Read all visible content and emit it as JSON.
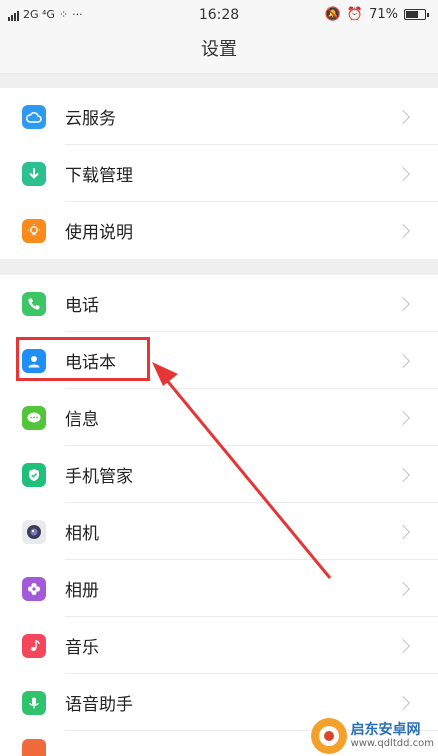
{
  "status_bar": {
    "left": "2G ⁴G",
    "time": "16:28",
    "battery_pct": "71%",
    "battery_level": 0.71
  },
  "header": {
    "title": "设置"
  },
  "sections": [
    {
      "items": [
        {
          "label": "云服务",
          "icon": "cloud-icon",
          "color": "#2f9bf0"
        },
        {
          "label": "下载管理",
          "icon": "download-icon",
          "color": "#2cbf8f"
        },
        {
          "label": "使用说明",
          "icon": "lightbulb-icon",
          "color": "#f98a1c"
        }
      ]
    },
    {
      "items": [
        {
          "label": "电话",
          "icon": "phone-icon",
          "color": "#3ec566"
        },
        {
          "label": "电话本",
          "icon": "contacts-icon",
          "color": "#1f8ff5"
        },
        {
          "label": "信息",
          "icon": "message-icon",
          "color": "#52c53b"
        },
        {
          "label": "手机管家",
          "icon": "shield-icon",
          "color": "#20c07a"
        },
        {
          "label": "相机",
          "icon": "camera-icon",
          "color": "#4b4b66"
        },
        {
          "label": "相册",
          "icon": "album-icon",
          "color": "#a25ad8"
        },
        {
          "label": "音乐",
          "icon": "music-icon",
          "color": "#f4475b"
        },
        {
          "label": "语音助手",
          "icon": "microphone-icon",
          "color": "#31c26e"
        }
      ]
    }
  ],
  "annotation": {
    "color": "#e53535"
  },
  "watermark": {
    "name": "启东安卓网",
    "url": "www.qdltdd.com"
  }
}
